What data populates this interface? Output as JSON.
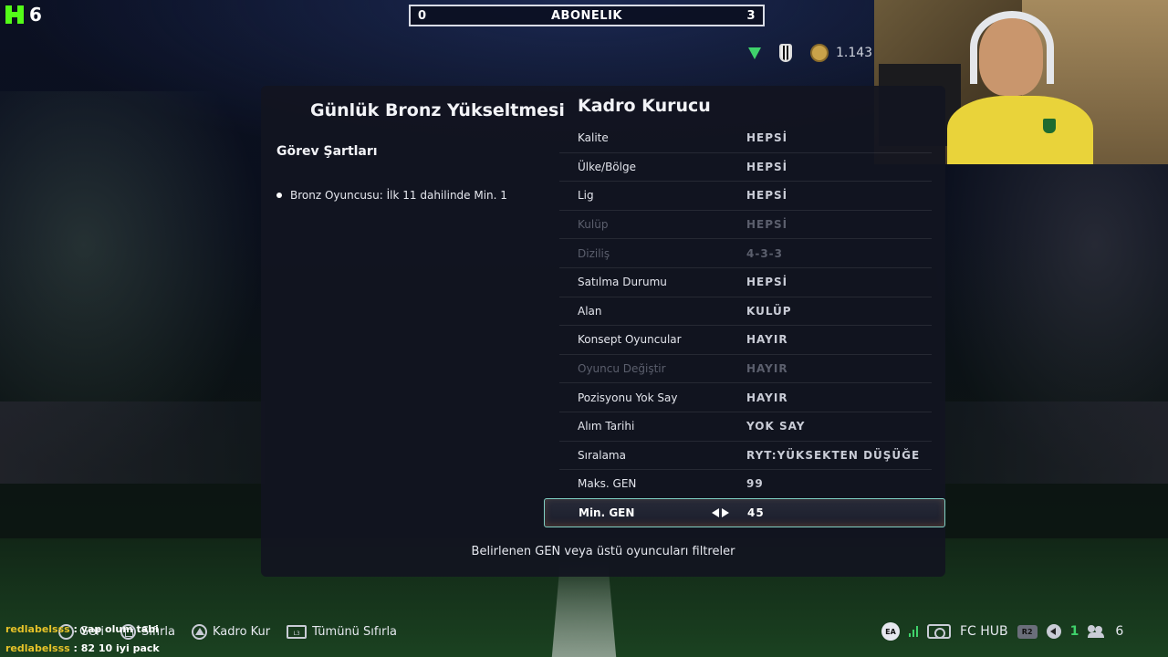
{
  "stream": {
    "kick_viewers": "6",
    "subscription": {
      "left_count": "0",
      "label": "ABONELIK",
      "right_count": "3"
    },
    "coins": "1.143",
    "chat": [
      {
        "user": "redlabelsss",
        "message": " : yap olum tabi"
      },
      {
        "user": "redlabelsss",
        "message": " : 82 10 iyi pack"
      }
    ]
  },
  "panel": {
    "left_title": "Günlük Bronz Yükseltmesi",
    "requirements_title": "Görev Şartları",
    "requirements": [
      "Bronz Oyuncusu: İlk 11 dahilinde Min. 1"
    ],
    "right_title": "Kadro Kurucu",
    "rows": [
      {
        "label": "Kalite",
        "value": "HEPSİ",
        "dim": false
      },
      {
        "label": "Ülke/Bölge",
        "value": "HEPSİ",
        "dim": false
      },
      {
        "label": "Lig",
        "value": "HEPSİ",
        "dim": false
      },
      {
        "label": "Kulüp",
        "value": "HEPSİ",
        "dim": true
      },
      {
        "label": "Diziliş",
        "value": "4-3-3",
        "dim": true
      },
      {
        "label": "Satılma Durumu",
        "value": "HEPSİ",
        "dim": false
      },
      {
        "label": "Alan",
        "value": "KULÜP",
        "dim": false
      },
      {
        "label": "Konsept Oyuncular",
        "value": "HAYIR",
        "dim": false
      },
      {
        "label": "Oyuncu Değiştir",
        "value": "HAYIR",
        "dim": true
      },
      {
        "label": "Pozisyonu Yok Say",
        "value": "HAYIR",
        "dim": false
      },
      {
        "label": "Alım Tarihi",
        "value": "YOK SAY",
        "dim": false
      },
      {
        "label": "Sıralama",
        "value": "RYT:YÜKSEKTEN DÜŞÜĞE",
        "dim": false
      },
      {
        "label": "Maks. GEN",
        "value": "99",
        "dim": false
      }
    ],
    "selected_row": {
      "label": "Min. GEN",
      "value": "45"
    },
    "hint": "Belirlenen GEN veya üstü oyuncuları filtreler"
  },
  "footer": {
    "back": "Geri",
    "reset": "Sıfırla",
    "build": "Kadro Kur",
    "reset_all": "Tümünü Sıfırla",
    "ea_label": "EA",
    "fc_hub": "FC HUB",
    "r2_label": "R2",
    "touchpad_label": "L3",
    "online_friends": "1",
    "party_count": "6"
  },
  "colors": {
    "accent_green": "#3fd26b",
    "selected_border": "#7fd0c4",
    "chat_user": "#e6c229"
  }
}
